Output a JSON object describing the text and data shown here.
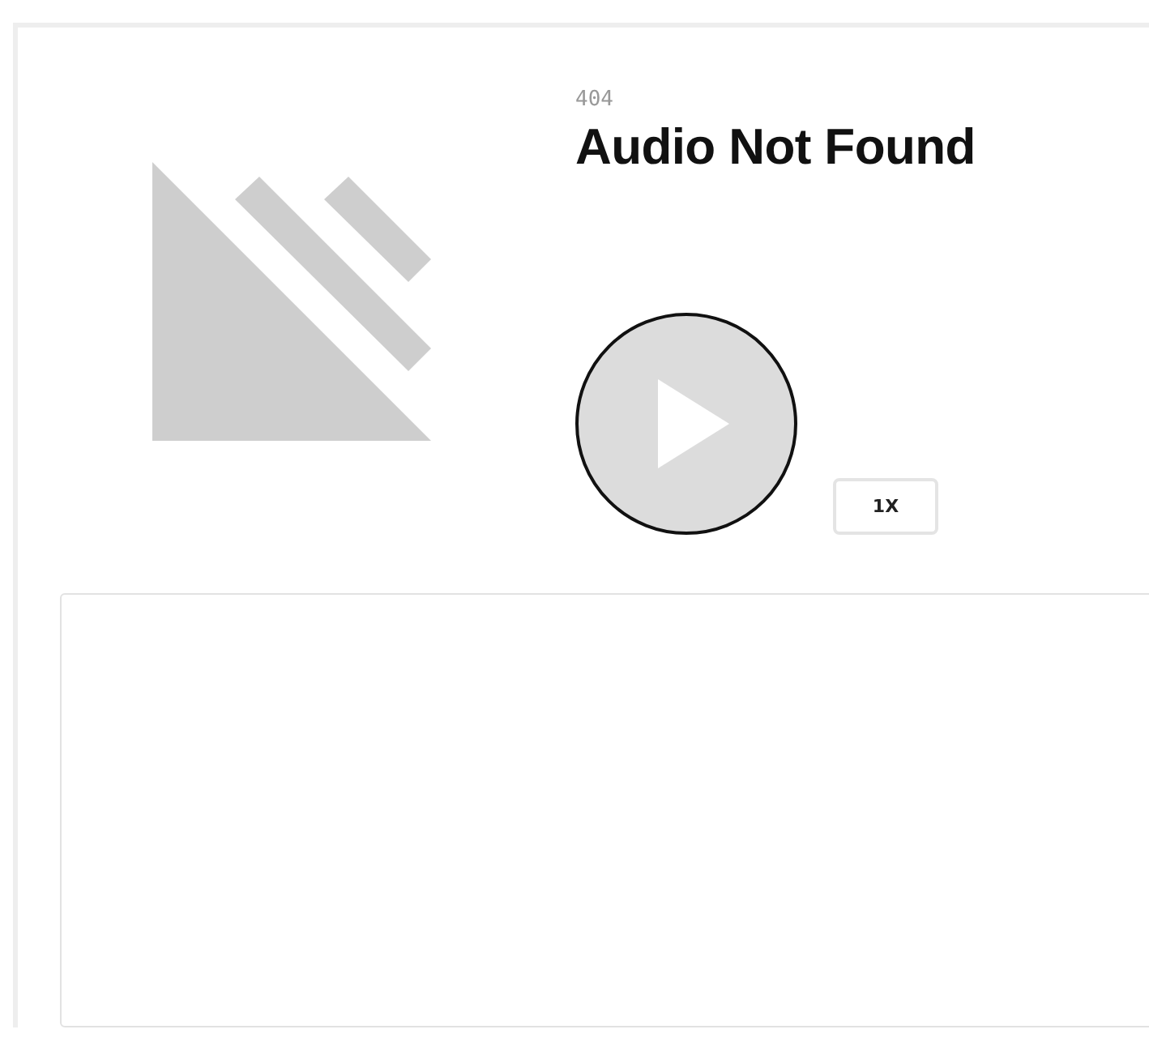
{
  "player": {
    "code": "404",
    "title": "Audio Not Found",
    "speed": "1X"
  }
}
